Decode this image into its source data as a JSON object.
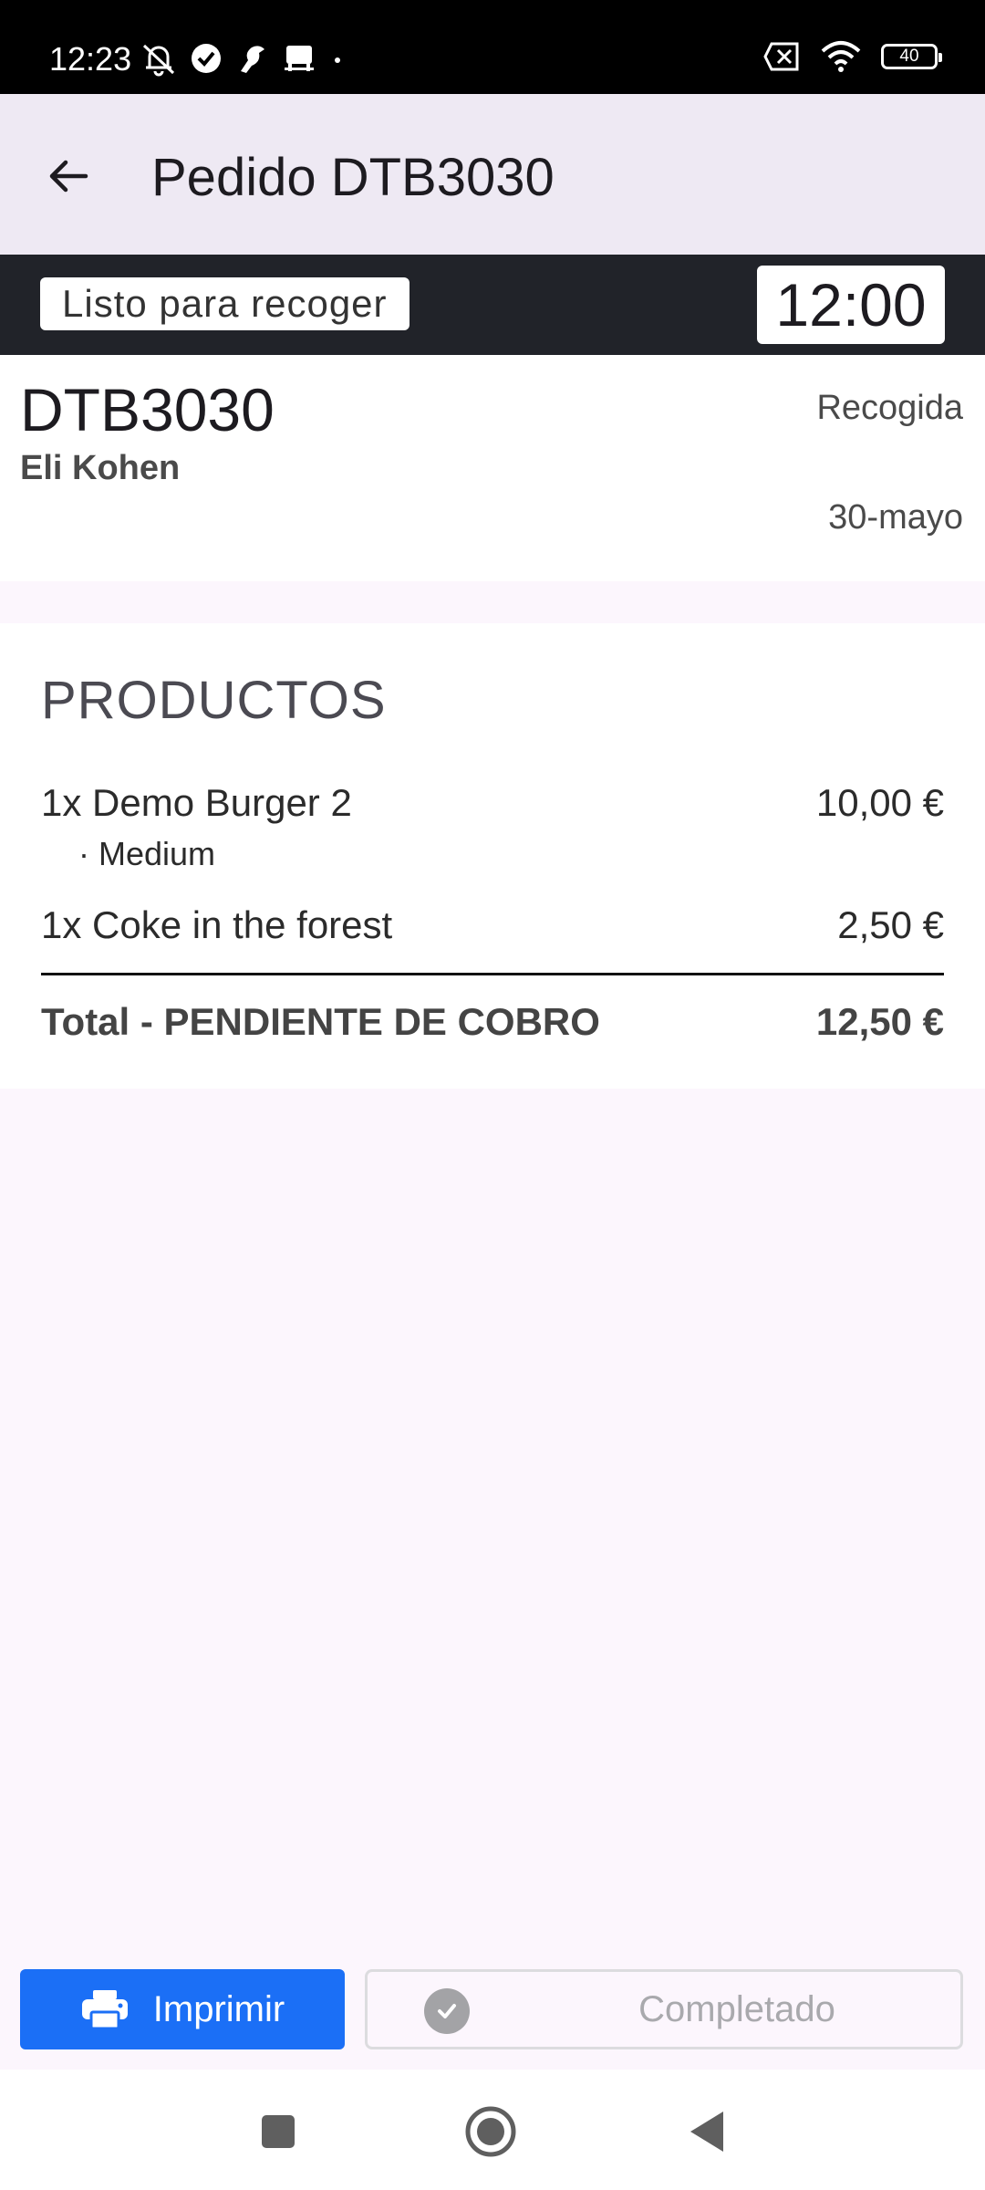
{
  "status_bar": {
    "time": "12:23",
    "battery_level": "40",
    "left_icons": [
      "mute-bell-icon",
      "check-circle-icon",
      "bird-icon",
      "delivery-cart-icon",
      "dot-icon"
    ],
    "right_icons": [
      "no-sim-icon",
      "wifi-icon",
      "battery-icon"
    ]
  },
  "app_bar": {
    "title": "Pedido DTB3030"
  },
  "status_strip": {
    "status_label": "Listo para recoger",
    "time": "12:00"
  },
  "order": {
    "code": "DTB3030",
    "customer": "Eli Kohen",
    "type": "Recogida",
    "date": "30-mayo"
  },
  "products": {
    "heading": "PRODUCTOS",
    "items": [
      {
        "label": "1x Demo Burger 2",
        "price": "10,00 €",
        "modifier": "· Medium"
      },
      {
        "label": "1x Coke in the forest",
        "price": "2,50 €"
      }
    ],
    "total_label": "Total - PENDIENTE DE COBRO",
    "total_price": "12,50 €"
  },
  "actions": {
    "print_label": "Imprimir",
    "complete_label": "Completado"
  },
  "colors": {
    "primary": "#1b6ff6",
    "strip_bg": "#212329",
    "app_bar_bg": "#eee9f3",
    "page_bg": "#fcf6fd"
  }
}
